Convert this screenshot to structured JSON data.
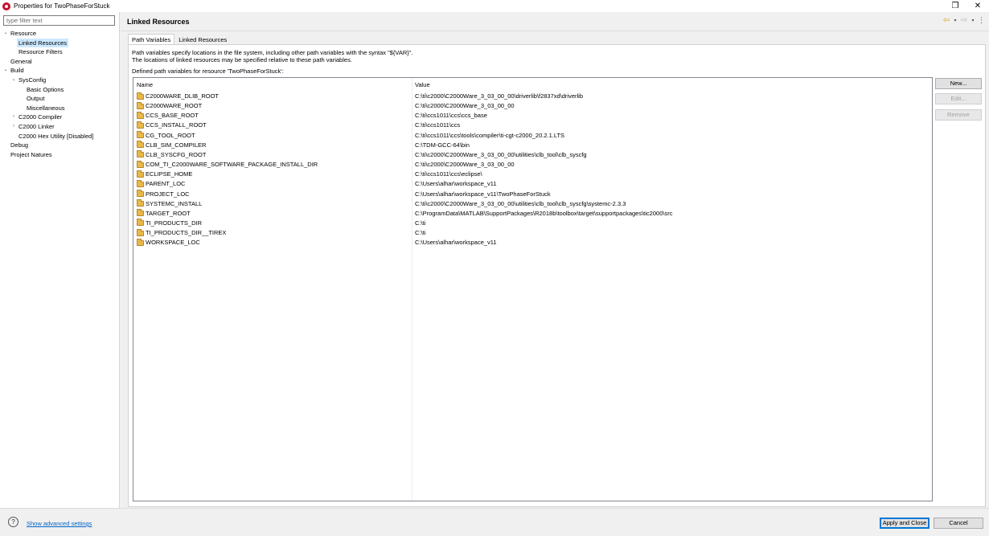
{
  "window": {
    "title": "Properties for TwoPhaseForStuck",
    "controls": {
      "restore": "❐",
      "close": "✕"
    }
  },
  "left": {
    "filter_placeholder": "type filter text",
    "tree": [
      {
        "label": "Resource",
        "level": 0,
        "twisty": "⌄",
        "selected": false
      },
      {
        "label": "Linked Resources",
        "level": 1,
        "twisty": "",
        "selected": true
      },
      {
        "label": "Resource Filters",
        "level": 1,
        "twisty": "",
        "selected": false
      },
      {
        "label": "General",
        "level": 0,
        "twisty": "",
        "selected": false
      },
      {
        "label": "Build",
        "level": 0,
        "twisty": "⌄",
        "selected": false
      },
      {
        "label": "SysConfig",
        "level": 1,
        "twisty": "⌄",
        "selected": false
      },
      {
        "label": "Basic Options",
        "level": 2,
        "twisty": "",
        "selected": false
      },
      {
        "label": "Output",
        "level": 2,
        "twisty": "",
        "selected": false
      },
      {
        "label": "Miscellaneous",
        "level": 2,
        "twisty": "",
        "selected": false
      },
      {
        "label": "C2000 Compiler",
        "level": 1,
        "twisty": "›",
        "selected": false
      },
      {
        "label": "C2000 Linker",
        "level": 1,
        "twisty": "›",
        "selected": false
      },
      {
        "label": "C2000 Hex Utility  [Disabled]",
        "level": 1,
        "twisty": "",
        "selected": false
      },
      {
        "label": "Debug",
        "level": 0,
        "twisty": "",
        "selected": false
      },
      {
        "label": "Project Natures",
        "level": 0,
        "twisty": "",
        "selected": false
      }
    ]
  },
  "header": {
    "title": "Linked Resources",
    "back": "⇦",
    "back_menu": "▾",
    "forward": "⇨",
    "forward_menu": "▾",
    "view_menu": "⋮"
  },
  "tabs": [
    {
      "label": "Path Variables",
      "active": true
    },
    {
      "label": "Linked Resources",
      "active": false
    }
  ],
  "description": {
    "line1": "Path variables specify locations in the file system, including other path variables with the syntax \"${VAR}\".",
    "line2": "The locations of linked resources may be specified relative to these path variables.",
    "line3": "Defined path variables for resource 'TwoPhaseForStuck':"
  },
  "table": {
    "columns": {
      "name": "Name",
      "value": "Value"
    },
    "rows": [
      {
        "name": "C2000WARE_DLIB_ROOT",
        "value": "C:\\ti\\c2000\\C2000Ware_3_03_00_00\\driverlib\\f2837xd\\driverlib"
      },
      {
        "name": "C2000WARE_ROOT",
        "value": "C:\\ti\\c2000\\C2000Ware_3_03_00_00"
      },
      {
        "name": "CCS_BASE_ROOT",
        "value": "C:\\ti\\ccs1011\\ccs\\ccs_base"
      },
      {
        "name": "CCS_INSTALL_ROOT",
        "value": "C:\\ti\\ccs1011\\ccs"
      },
      {
        "name": "CG_TOOL_ROOT",
        "value": "C:\\ti\\ccs1011\\ccs\\tools\\compiler\\ti-cgt-c2000_20.2.1.LTS"
      },
      {
        "name": "CLB_SIM_COMPILER",
        "value": "C:\\TDM-GCC-64\\bin"
      },
      {
        "name": "CLB_SYSCFG_ROOT",
        "value": "C:\\ti\\c2000\\C2000Ware_3_03_00_00\\utilities\\clb_tool\\clb_syscfg"
      },
      {
        "name": "COM_TI_C2000WARE_SOFTWARE_PACKAGE_INSTALL_DIR",
        "value": "C:\\ti\\c2000\\C2000Ware_3_03_00_00"
      },
      {
        "name": "ECLIPSE_HOME",
        "value": "C:\\ti\\ccs1011\\ccs\\eclipse\\"
      },
      {
        "name": "PARENT_LOC",
        "value": "C:\\Users\\alhar\\workspace_v11"
      },
      {
        "name": "PROJECT_LOC",
        "value": "C:\\Users\\alhar\\workspace_v11\\TwoPhaseForStuck"
      },
      {
        "name": "SYSTEMC_INSTALL",
        "value": "C:\\ti\\c2000\\C2000Ware_3_03_00_00\\utilities\\clb_tool\\clb_syscfg\\systemc-2.3.3"
      },
      {
        "name": "TARGET_ROOT",
        "value": "C:\\ProgramData\\MATLAB\\SupportPackages\\R2018b\\toolbox\\target\\supportpackages\\tic2000\\src"
      },
      {
        "name": "TI_PRODUCTS_DIR",
        "value": "C:\\ti"
      },
      {
        "name": "TI_PRODUCTS_DIR__TIREX",
        "value": "C:\\ti"
      },
      {
        "name": "WORKSPACE_LOC",
        "value": "C:\\Users\\alhar\\workspace_v11"
      }
    ]
  },
  "buttons": {
    "new": "New...",
    "edit": "Edit...",
    "remove": "Remove"
  },
  "footer": {
    "help": "?",
    "advanced_link": "Show advanced settings",
    "apply_close": "Apply and Close",
    "cancel": "Cancel"
  }
}
